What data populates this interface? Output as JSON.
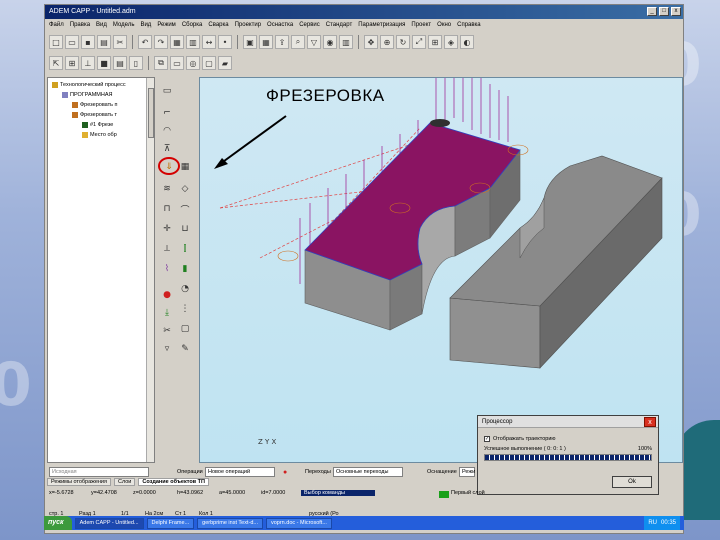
{
  "app": {
    "title": "ADEM CAPP - Untitled.adm",
    "menu": [
      "Файл",
      "Правка",
      "Вид",
      "Модель",
      "Вид",
      "Режим",
      "Сборка",
      "Сварка",
      "Проектир",
      "Оснастка",
      "Сервис",
      "Стандарт",
      "Параметризация",
      "Проект",
      "Окно",
      "Справка"
    ],
    "window_buttons": [
      "_",
      "□",
      "x"
    ]
  },
  "slide": {
    "heading": "ФРЕЗЕРОВКА"
  },
  "tree": {
    "items": [
      {
        "label": "Технологический процесс",
        "level": 0
      },
      {
        "label": "ПРОГРАММНАЯ",
        "level": 1
      },
      {
        "label": "Фрезеровать п",
        "level": 2
      },
      {
        "label": "Фрезеровать т",
        "level": 2
      },
      {
        "label": "#1 Фрезе",
        "level": 3
      },
      {
        "label": "Место обр",
        "level": 3
      }
    ]
  },
  "dialog": {
    "title": "Процессор",
    "close_label": "x",
    "checkbox_label": "Отображать траекторию",
    "checkbox_mark": "✓",
    "status": "Успешное выполнение ( 0: 0: 1 )",
    "percent": "100%",
    "progress": 1.0,
    "ok_label": "Ok"
  },
  "tabs": [
    "Режимы отображения",
    "Слои",
    "Создание объектов ТП"
  ],
  "operations": {
    "prev_label": "Исходная",
    "operation_label": "Операции",
    "operation_value": "Новое операций",
    "transitions_label": "Переходы",
    "transitions_value": "Основные переходы",
    "tooling_label": "Оснащение",
    "tooling_value": "Режи"
  },
  "coords": {
    "x": "x=-5.6728",
    "y": "y=42.4708",
    "z": "z=0.0000",
    "h": "h=43.0962",
    "a": "a=45.0000",
    "id": "id=7.0000",
    "select_status": "Выбор команды",
    "layer": "Первый слой"
  },
  "pagebar": {
    "page": "стр. 1",
    "section": "Разд 1",
    "page_count": "1/1",
    "position": "На 2см",
    "line": "Ст 1",
    "column": "Кол 1",
    "lang": "русский (Ро"
  },
  "taskbar": {
    "start": "пуск",
    "tasks": [
      "Adem CAPP - Untitled...",
      "Delphi Frame...",
      "gerbprime inst Text-d...",
      "voprn.doc - Microsoft..."
    ],
    "tray_lang": "RU",
    "time": "00:35"
  },
  "axis_label": "Z Y X"
}
